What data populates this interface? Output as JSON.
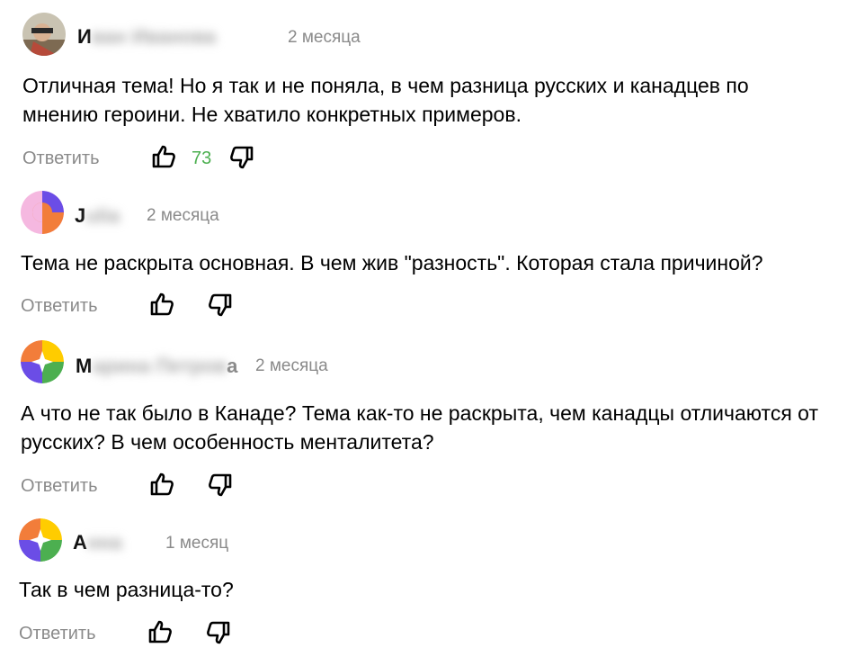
{
  "comments": [
    {
      "author_visible": "И",
      "author_blurred": "ван Иванова",
      "time": "2 месяца",
      "text": "Отличная тема! Но я так и не поняла, в чем разница русских и канадцев по мнению героини. Не хватило конкретных примеров.",
      "reply_label": "Ответить",
      "likes": "73"
    },
    {
      "author_visible": "J",
      "author_blurred": "ulia",
      "time": "2 месяца",
      "text": "Тема не раскрыта основная. В чем жив \"разность\". Которая стала причиной?",
      "reply_label": "Ответить"
    },
    {
      "author_visible": "М",
      "author_blurred": "арина Петров",
      "author_suffix": "а",
      "time": "2 месяца",
      "text": "А что не так было в Канаде? Тема как-то не раскрыта, чем канадцы отличаются от русских? В чем особенность менталитета?",
      "reply_label": "Ответить"
    },
    {
      "author_visible": "А",
      "author_blurred": "нна",
      "time": "1 месяц",
      "text": "Так в чем разница-то?",
      "reply_label": "Ответить"
    }
  ],
  "colors": {
    "like_count": "#4caf50",
    "meta_gray": "#8a8a8a"
  }
}
